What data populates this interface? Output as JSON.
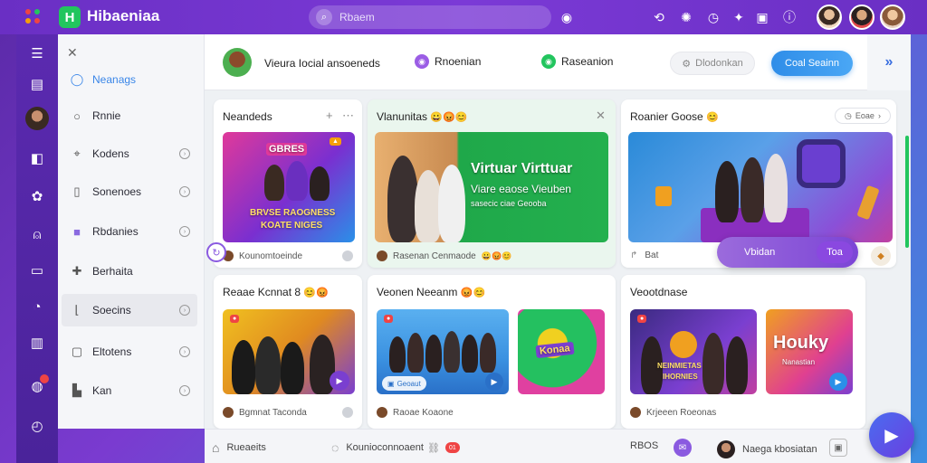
{
  "app": {
    "title": "Hibaeniaa",
    "logo_letter": "H"
  },
  "search": {
    "placeholder": "Rbaem"
  },
  "sidebar": {
    "items": [
      {
        "label": "Neanags",
        "icon": "circle-icon",
        "active": true
      },
      {
        "label": "Rnnie",
        "icon": "ring-icon"
      },
      {
        "label": "Kodens",
        "icon": "tag-icon"
      },
      {
        "label": "Sonenoes",
        "icon": "bookmark-icon"
      },
      {
        "label": "Rbdanies",
        "icon": "square-icon"
      },
      {
        "label": "Berhaita",
        "icon": "pin-icon"
      },
      {
        "label": "Soecins",
        "icon": "chart-icon"
      },
      {
        "label": "Eltotens",
        "icon": "flag-icon"
      },
      {
        "label": "Kan",
        "icon": "stats-icon"
      }
    ]
  },
  "header": {
    "title": "Vieura Iocial ansoeneds",
    "chip1": "Rnoenian",
    "chip2": "Raseanion",
    "ghost_button": "Dlodonkan",
    "primary_button": "Coal Seainn"
  },
  "cards": {
    "c1": {
      "title": "Neandeds",
      "thumb_title": "GBRES",
      "thumb_line1": "BRVSE RAOGNESS",
      "thumb_line2": "KOATE NIGES",
      "footer": "Kounomtoeinde"
    },
    "c2": {
      "title": "Vlanunitas",
      "emoji": "😀😡😊",
      "thumb_title": "Virtuar Virttuar",
      "thumb_line1": "Viare eaose Vieuben",
      "thumb_line2": "sasecic ciae Geooba",
      "footer": "Rasenan Cenmaode"
    },
    "c3": {
      "title": "Roanier Goose",
      "emoji": "😊",
      "chip": "Eoae",
      "footer": "Bat"
    },
    "c4": {
      "title": "Reaae Kcnnat 8",
      "emoji": "😊😡",
      "footer": "Bgmnat Taconda"
    },
    "c5": {
      "title": "Veonen Neeanm",
      "emoji": "😡😊",
      "thumb_label": "Geoaut",
      "thumb2_text": "Konaa",
      "footer": "Raoae Koaone"
    },
    "c6": {
      "title": "Veootdnase",
      "thumb_line1": "NEINMIETAS",
      "thumb_line2": "IHORNIES",
      "thumb2_text": "Houky",
      "thumb2_sub": "Nanastian",
      "footer": "Krjeeen Roeonas"
    }
  },
  "float_pill": {
    "label": "Vbidan",
    "inner": "Toa"
  },
  "bottombar": {
    "item1": "Rueaeits",
    "item2": "Kounioconnoaent",
    "badge": "01",
    "label3": "RBOS",
    "item4": "Naega kbosiatan"
  },
  "colors": {
    "accent": "#2f8de8",
    "topbar": "#7b3ad6",
    "rail": "#5b2ab0",
    "fab": "#4a6cf0"
  }
}
